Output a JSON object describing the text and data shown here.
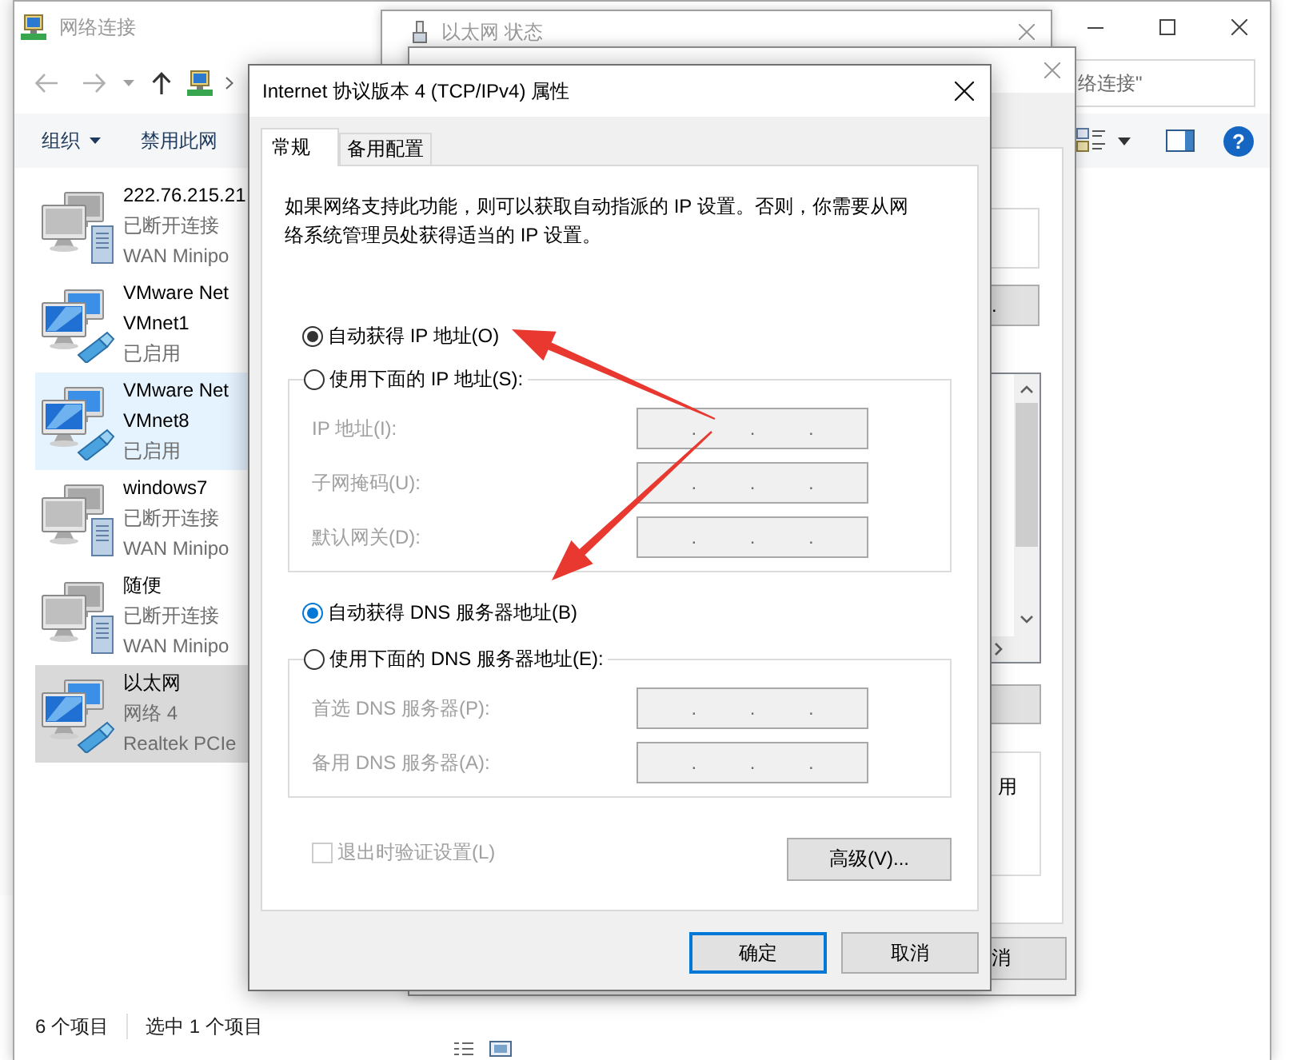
{
  "explorer": {
    "title": "网络连接",
    "search": {
      "placeholder": "络连接\""
    },
    "toolbar": [
      {
        "label": "组织",
        "kind": "menu"
      },
      {
        "label": "禁用此网",
        "kind": "button"
      }
    ],
    "help": "?",
    "items": [
      {
        "lines": [
          {
            "text": "222.76.215.21",
            "kind": "name"
          },
          {
            "text": "已断开连接",
            "kind": "detail"
          },
          {
            "text": "WAN Minipo",
            "kind": "detail"
          }
        ],
        "kind": "wan",
        "selected": false,
        "hovered": false
      },
      {
        "lines": [
          {
            "text": "VMware Net",
            "kind": "name"
          },
          {
            "text": "VMnet1",
            "kind": "name"
          },
          {
            "text": "已启用",
            "kind": "detail"
          }
        ],
        "kind": "ethernet",
        "selected": false,
        "hovered": false
      },
      {
        "lines": [
          {
            "text": "VMware Net",
            "kind": "name"
          },
          {
            "text": "VMnet8",
            "kind": "name"
          },
          {
            "text": "已启用",
            "kind": "detail"
          }
        ],
        "kind": "ethernet",
        "selected": false,
        "hovered": true
      },
      {
        "lines": [
          {
            "text": "windows7",
            "kind": "name"
          },
          {
            "text": "已断开连接",
            "kind": "detail"
          },
          {
            "text": "WAN Minipo",
            "kind": "detail"
          }
        ],
        "kind": "wan",
        "selected": false,
        "hovered": false
      },
      {
        "lines": [
          {
            "text": "随便",
            "kind": "name"
          },
          {
            "text": "已断开连接",
            "kind": "detail"
          },
          {
            "text": "WAN Minipo",
            "kind": "detail"
          }
        ],
        "kind": "wan",
        "selected": false,
        "hovered": false
      },
      {
        "lines": [
          {
            "text": "以太网",
            "kind": "name"
          },
          {
            "text": "网络 4",
            "kind": "detail"
          },
          {
            "text": "Realtek PCIe",
            "kind": "detail"
          }
        ],
        "kind": "ethernet",
        "selected": true,
        "hovered": false
      }
    ],
    "status_bar": {
      "count": "6 个项目",
      "selection": "选中 1 个项目"
    }
  },
  "status_window": {
    "title": "以太网 状态"
  },
  "properties_window": {
    "button_text": ".",
    "group_text": "用",
    "cancel_button": "消"
  },
  "dialog": {
    "title": "Internet 协议版本 4 (TCP/IPv4) 属性",
    "tabs": [
      {
        "label": "常规",
        "selected": true
      },
      {
        "label": "备用配置",
        "selected": false
      }
    ],
    "description": "如果网络支持此功能，则可以获取自动指派的 IP 设置。否则，你需要从网络系统管理员处获得适当的 IP 设置。",
    "sections": [
      {
        "options": [
          {
            "label": "自动获得 IP 地址(O)",
            "selected": true,
            "color": "#333333"
          },
          {
            "label": "使用下面的 IP 地址(S):",
            "selected": false,
            "color": "#333333"
          }
        ],
        "fields": [
          {
            "label": "IP 地址(I):",
            "disabled": true,
            "separators": [
              ".",
              ".",
              "."
            ]
          },
          {
            "label": "子网掩码(U):",
            "disabled": true,
            "separators": [
              ".",
              ".",
              "."
            ]
          },
          {
            "label": "默认网关(D):",
            "disabled": true,
            "separators": [
              ".",
              ".",
              "."
            ]
          }
        ]
      },
      {
        "options": [
          {
            "label": "自动获得 DNS 服务器地址(B)",
            "selected": true,
            "color": "#0078d7"
          },
          {
            "label": "使用下面的 DNS 服务器地址(E):",
            "selected": false,
            "color": "#333333"
          }
        ],
        "fields": [
          {
            "label": "首选 DNS 服务器(P):",
            "disabled": true,
            "separators": [
              ".",
              ".",
              "."
            ]
          },
          {
            "label": "备用 DNS 服务器(A):",
            "disabled": true,
            "separators": [
              ".",
              ".",
              "."
            ]
          }
        ]
      }
    ],
    "validate_checkbox": {
      "label": "退出时验证设置(L)",
      "checked": false,
      "disabled": true
    },
    "advanced_button": "高级(V)...",
    "buttons": [
      {
        "label": "确定",
        "default": true
      },
      {
        "label": "取消",
        "default": false
      }
    ]
  }
}
